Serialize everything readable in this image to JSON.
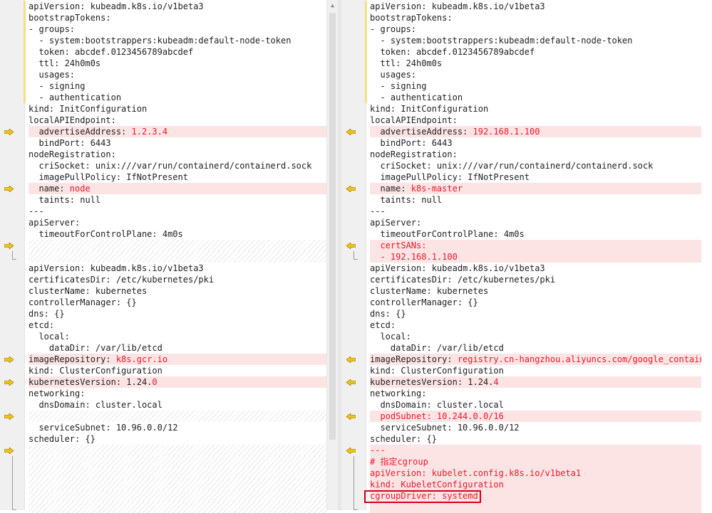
{
  "diff": {
    "left": {
      "lines": [
        {
          "text": "apiVersion: kubeadm.k8s.io/v1beta3",
          "changed": true
        },
        {
          "text": "bootstrapTokens:",
          "changed": true
        },
        {
          "text": "- groups:",
          "changed": true
        },
        {
          "text": "  - system:bootstrappers:kubeadm:default-node-token",
          "changed": true
        },
        {
          "text": "  token: abcdef.0123456789abcdef",
          "changed": true
        },
        {
          "text": "  ttl: 24h0m0s",
          "changed": true
        },
        {
          "text": "  usages:",
          "changed": true
        },
        {
          "text": "  - signing",
          "changed": true
        },
        {
          "text": "  - authentication",
          "changed": true
        },
        {
          "text": "kind: InitConfiguration"
        },
        {
          "text": "localAPIEndpoint:"
        },
        {
          "prefix": "  advertiseAddress: ",
          "hl": "1.2.3.4",
          "diff": true,
          "icon": "arrow-right"
        },
        {
          "text": "  bindPort: 6443"
        },
        {
          "text": "nodeRegistration:"
        },
        {
          "text": "  criSocket: unix:///var/run/containerd/containerd.sock"
        },
        {
          "text": "  imagePullPolicy: IfNotPresent"
        },
        {
          "prefix": "  name: ",
          "hl": "node",
          "diff": true,
          "icon": "arrow-right"
        },
        {
          "text": "  taints: null"
        },
        {
          "text": "---"
        },
        {
          "text": "apiServer:"
        },
        {
          "text": "  timeoutForControlPlane: 4m0s"
        },
        {
          "placeholder": true,
          "icon": "arrow-right"
        },
        {
          "placeholder": true,
          "icon": "bracket-end"
        },
        {
          "text": "apiVersion: kubeadm.k8s.io/v1beta3"
        },
        {
          "text": "certificatesDir: /etc/kubernetes/pki"
        },
        {
          "text": "clusterName: kubernetes"
        },
        {
          "text": "controllerManager: {}"
        },
        {
          "text": "dns: {}"
        },
        {
          "text": "etcd:"
        },
        {
          "text": "  local:"
        },
        {
          "text": "    dataDir: /var/lib/etcd"
        },
        {
          "prefix": "imageRepository: ",
          "hl": "k8s.gcr.io",
          "diff": true,
          "icon": "arrow-right"
        },
        {
          "text": "kind: ClusterConfiguration"
        },
        {
          "prefix": "kubernetesVersion: 1.24.",
          "hl": "0",
          "diff": true,
          "icon": "arrow-right"
        },
        {
          "text": "networking:"
        },
        {
          "text": "  dnsDomain: cluster.local"
        },
        {
          "placeholder": true,
          "icon": "arrow-right"
        },
        {
          "text": "  serviceSubnet: 10.96.0.0/12"
        },
        {
          "text": "scheduler: {}"
        },
        {
          "placeholder": true,
          "icon": "arrow-right"
        },
        {
          "placeholder": true,
          "icon": "bracket-mid"
        },
        {
          "placeholder": true,
          "icon": "bracket-mid"
        },
        {
          "placeholder": true,
          "icon": "bracket-mid"
        },
        {
          "placeholder": true,
          "icon": "bracket-mid"
        },
        {
          "placeholder": true,
          "icon": "bracket-end"
        }
      ]
    },
    "right": {
      "lines": [
        {
          "text": "apiVersion: kubeadm.k8s.io/v1beta3",
          "changed": true
        },
        {
          "text": "bootstrapTokens:",
          "changed": true
        },
        {
          "text": "- groups:",
          "changed": true
        },
        {
          "text": "  - system:bootstrappers:kubeadm:default-node-token",
          "changed": true
        },
        {
          "text": "  token: abcdef.0123456789abcdef",
          "changed": true
        },
        {
          "text": "  ttl: 24h0m0s",
          "changed": true
        },
        {
          "text": "  usages:",
          "changed": true
        },
        {
          "text": "  - signing",
          "changed": true
        },
        {
          "text": "  - authentication",
          "changed": true
        },
        {
          "text": "kind: InitConfiguration"
        },
        {
          "text": "localAPIEndpoint:"
        },
        {
          "prefix": "  advertiseAddress: ",
          "hl": "192.168.1.100",
          "diff": true,
          "icon": "arrow-left"
        },
        {
          "text": "  bindPort: 6443"
        },
        {
          "text": "nodeRegistration:"
        },
        {
          "text": "  criSocket: unix:///var/run/containerd/containerd.sock"
        },
        {
          "text": "  imagePullPolicy: IfNotPresent"
        },
        {
          "prefix": "  name: ",
          "hl": "k8s-master",
          "diff": true,
          "icon": "arrow-left"
        },
        {
          "text": "  taints: null"
        },
        {
          "text": "---"
        },
        {
          "text": "apiServer:"
        },
        {
          "text": "  timeoutForControlPlane: 4m0s"
        },
        {
          "hl": "  certSANs:",
          "diff": true,
          "icon": "arrow-left"
        },
        {
          "hl": "  - 192.168.1.100",
          "diff": true,
          "icon": "bracket-end"
        },
        {
          "text": "apiVersion: kubeadm.k8s.io/v1beta3"
        },
        {
          "text": "certificatesDir: /etc/kubernetes/pki"
        },
        {
          "text": "clusterName: kubernetes"
        },
        {
          "text": "controllerManager: {}"
        },
        {
          "text": "dns: {}"
        },
        {
          "text": "etcd:"
        },
        {
          "text": "  local:"
        },
        {
          "text": "    dataDir: /var/lib/etcd"
        },
        {
          "prefix": "imageRepository: ",
          "hl": "registry.cn-hangzhou.aliyuncs.com/google_containers",
          "diff": true,
          "icon": "arrow-left"
        },
        {
          "text": "kind: ClusterConfiguration"
        },
        {
          "prefix": "kubernetesVersion: 1.24.",
          "hl": "4",
          "diff": true,
          "icon": "arrow-left"
        },
        {
          "text": "networking:"
        },
        {
          "text": "  dnsDomain: cluster.local"
        },
        {
          "hl": "  podSubnet: 10.244.0.0/16",
          "diff": true,
          "icon": "arrow-left"
        },
        {
          "text": "  serviceSubnet: 10.96.0.0/12"
        },
        {
          "text": "scheduler: {}"
        },
        {
          "hl": "---",
          "diff": true,
          "icon": "arrow-left"
        },
        {
          "hl": "# 指定cgroup",
          "diff": true,
          "icon": "bracket-mid"
        },
        {
          "hl": "apiVersion: kubelet.config.k8s.io/v1beta1",
          "diff": true,
          "icon": "bracket-mid"
        },
        {
          "hl": "kind: KubeletConfiguration",
          "diff": true,
          "icon": "bracket-mid"
        },
        {
          "hl": "cgroupDriver: systemd",
          "diff": true,
          "icon": "bracket-mid"
        },
        {
          "placeholder": false,
          "diff": true,
          "hl": "",
          "icon": "bracket-end"
        }
      ]
    }
  },
  "colors": {
    "diff_bg": "#fde4e4",
    "diff_text": "#e8182b",
    "changed_marker": "#f2e085",
    "arrow_fill": "#f0c419",
    "annotation_box": "#d4001a"
  }
}
